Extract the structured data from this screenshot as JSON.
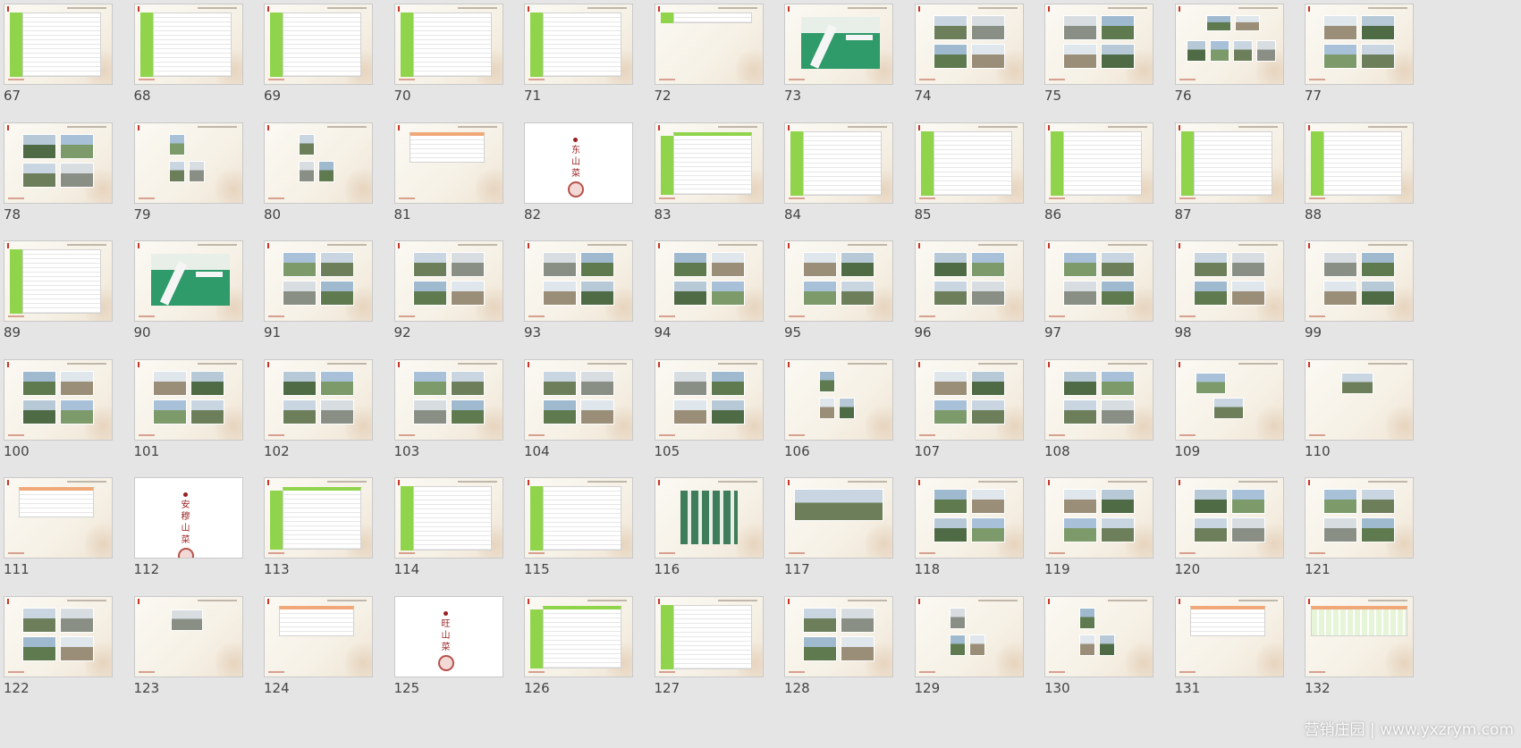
{
  "slides": [
    {
      "n": "67",
      "kind": "table"
    },
    {
      "n": "68",
      "kind": "table"
    },
    {
      "n": "69",
      "kind": "table"
    },
    {
      "n": "70",
      "kind": "table"
    },
    {
      "n": "71",
      "kind": "table"
    },
    {
      "n": "72",
      "kind": "tablesmall"
    },
    {
      "n": "73",
      "kind": "map"
    },
    {
      "n": "74",
      "kind": "photos4"
    },
    {
      "n": "75",
      "kind": "photos4"
    },
    {
      "n": "76",
      "kind": "photos6"
    },
    {
      "n": "77",
      "kind": "photos4"
    },
    {
      "n": "78",
      "kind": "photos4"
    },
    {
      "n": "79",
      "kind": "photos3"
    },
    {
      "n": "80",
      "kind": "photos3"
    },
    {
      "n": "81",
      "kind": "orangetable"
    },
    {
      "n": "82",
      "kind": "cover",
      "title": "东山菜"
    },
    {
      "n": "83",
      "kind": "tablehead"
    },
    {
      "n": "84",
      "kind": "table"
    },
    {
      "n": "85",
      "kind": "table"
    },
    {
      "n": "86",
      "kind": "table"
    },
    {
      "n": "87",
      "kind": "table"
    },
    {
      "n": "88",
      "kind": "table"
    },
    {
      "n": "89",
      "kind": "table"
    },
    {
      "n": "90",
      "kind": "map"
    },
    {
      "n": "91",
      "kind": "photos4"
    },
    {
      "n": "92",
      "kind": "photos4"
    },
    {
      "n": "93",
      "kind": "photos4"
    },
    {
      "n": "94",
      "kind": "photos4"
    },
    {
      "n": "95",
      "kind": "photos4"
    },
    {
      "n": "96",
      "kind": "photos4"
    },
    {
      "n": "97",
      "kind": "photos4"
    },
    {
      "n": "98",
      "kind": "photos4"
    },
    {
      "n": "99",
      "kind": "photos4"
    },
    {
      "n": "100",
      "kind": "photos4"
    },
    {
      "n": "101",
      "kind": "photos4"
    },
    {
      "n": "102",
      "kind": "photos4"
    },
    {
      "n": "103",
      "kind": "photos4"
    },
    {
      "n": "104",
      "kind": "photos4"
    },
    {
      "n": "105",
      "kind": "photos4"
    },
    {
      "n": "106",
      "kind": "photos3"
    },
    {
      "n": "107",
      "kind": "photos4"
    },
    {
      "n": "108",
      "kind": "photos4"
    },
    {
      "n": "109",
      "kind": "photos2"
    },
    {
      "n": "110",
      "kind": "photos1"
    },
    {
      "n": "111",
      "kind": "orangetable"
    },
    {
      "n": "112",
      "kind": "cover",
      "title": "安穆山菜"
    },
    {
      "n": "113",
      "kind": "tablehead"
    },
    {
      "n": "114",
      "kind": "table"
    },
    {
      "n": "115",
      "kind": "table"
    },
    {
      "n": "116",
      "kind": "plan"
    },
    {
      "n": "117",
      "kind": "render"
    },
    {
      "n": "118",
      "kind": "photos4"
    },
    {
      "n": "119",
      "kind": "photos4"
    },
    {
      "n": "120",
      "kind": "photos4"
    },
    {
      "n": "121",
      "kind": "photos4"
    },
    {
      "n": "122",
      "kind": "photos4"
    },
    {
      "n": "123",
      "kind": "photos1"
    },
    {
      "n": "124",
      "kind": "orangetable"
    },
    {
      "n": "125",
      "kind": "cover",
      "title": "旺山菜"
    },
    {
      "n": "126",
      "kind": "tablehead"
    },
    {
      "n": "127",
      "kind": "table"
    },
    {
      "n": "128",
      "kind": "photos4"
    },
    {
      "n": "129",
      "kind": "photos3"
    },
    {
      "n": "130",
      "kind": "photos3"
    },
    {
      "n": "131",
      "kind": "orangetable"
    },
    {
      "n": "132",
      "kind": "widetable"
    }
  ],
  "watermark": "营销庄园 | www.yxzrym.com",
  "colors": {
    "background": "#e5e5e5",
    "green": "#8fd44a",
    "cover_red": "#9a1f1f",
    "orange": "#f0a878"
  }
}
